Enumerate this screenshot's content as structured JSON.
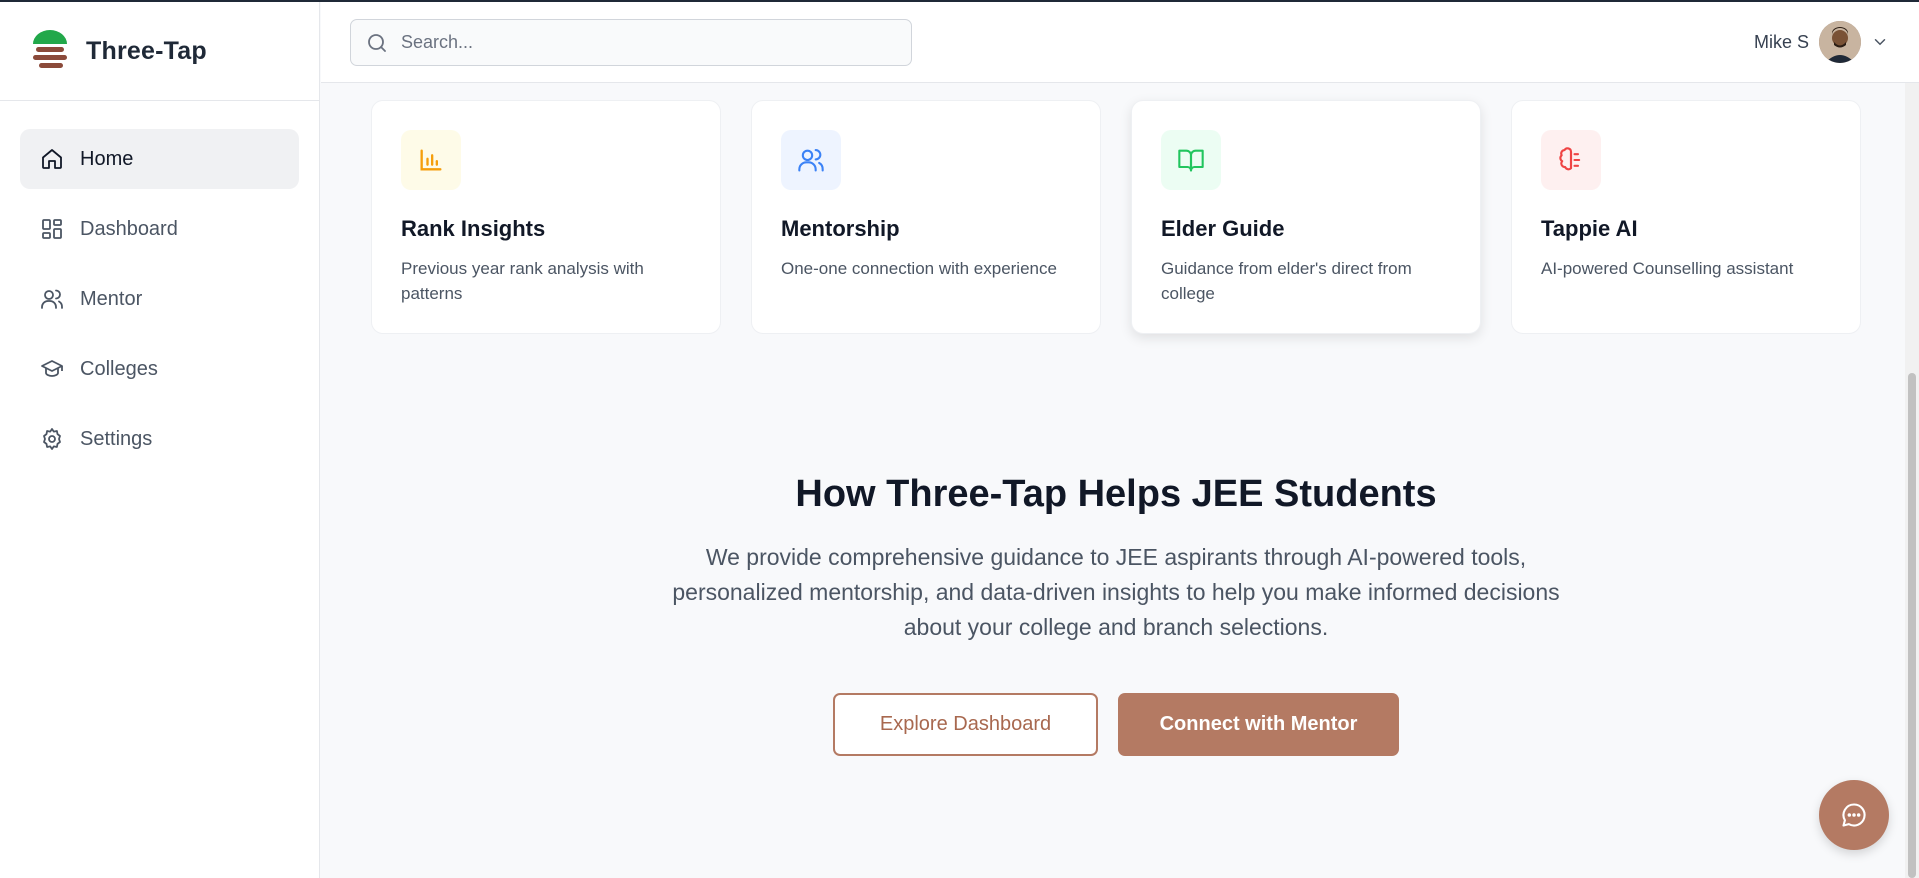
{
  "app": {
    "name": "Three-Tap"
  },
  "sidebar": {
    "items": [
      {
        "label": "Home",
        "icon": "home-icon",
        "active": true
      },
      {
        "label": "Dashboard",
        "icon": "dashboard-icon",
        "active": false
      },
      {
        "label": "Mentor",
        "icon": "users-icon",
        "active": false
      },
      {
        "label": "Colleges",
        "icon": "graduation-cap-icon",
        "active": false
      },
      {
        "label": "Settings",
        "icon": "gear-icon",
        "active": false
      }
    ]
  },
  "header": {
    "search": {
      "placeholder": "Search...",
      "value": ""
    },
    "user": {
      "name": "Mike S"
    }
  },
  "cards": [
    {
      "title": "Rank Insights",
      "description": "Previous year rank analysis with patterns",
      "icon": "bar-chart-icon",
      "icon_color": "#f59e0b",
      "icon_bg": "#fefbe8"
    },
    {
      "title": "Mentorship",
      "description": "One-one connection with experience",
      "icon": "users-icon",
      "icon_color": "#3b82f6",
      "icon_bg": "#eef4ff"
    },
    {
      "title": "Elder Guide",
      "description": "Guidance from elder's direct from college",
      "icon": "book-open-icon",
      "icon_color": "#22c55e",
      "icon_bg": "#ecfdf3"
    },
    {
      "title": "Tappie AI",
      "description": "AI-powered Counselling assistant",
      "icon": "brain-icon",
      "icon_color": "#ef4444",
      "icon_bg": "#fef0f0"
    }
  ],
  "section": {
    "title": "How Three-Tap Helps JEE Students",
    "text": "We provide comprehensive guidance to JEE aspirants through AI-powered tools, personalized mentorship, and data-driven insights to help you make informed decisions about your college and branch selections."
  },
  "actions": {
    "explore_label": "Explore Dashboard",
    "connect_label": "Connect with Mentor"
  },
  "colors": {
    "accent": "#b47a63",
    "logo_green": "#22a84a",
    "logo_brown": "#8b4a3a"
  }
}
